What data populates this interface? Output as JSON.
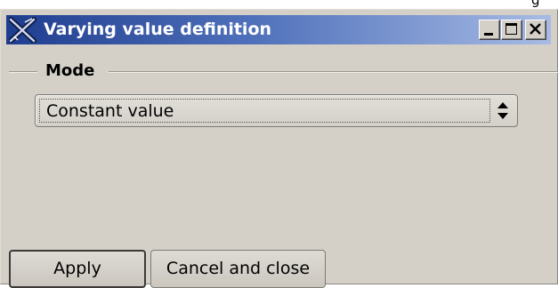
{
  "window": {
    "title": "Varying value definition",
    "corner_fragment": "g"
  },
  "titlebar_buttons": {
    "minimize_icon": "minimize-icon",
    "maximize_icon": "maximize-icon",
    "close_icon": "close-icon"
  },
  "mode_group": {
    "label": "Mode",
    "select": {
      "value": "Constant value",
      "arrow_icon": "up-down-arrows-icon"
    }
  },
  "buttons": {
    "apply_label": "Apply",
    "cancel_label": "Cancel and close"
  },
  "colors": {
    "titlebar_start": "#1f3d8f",
    "titlebar_end": "#a7bbe4",
    "window_bg": "#d4d0c8"
  }
}
